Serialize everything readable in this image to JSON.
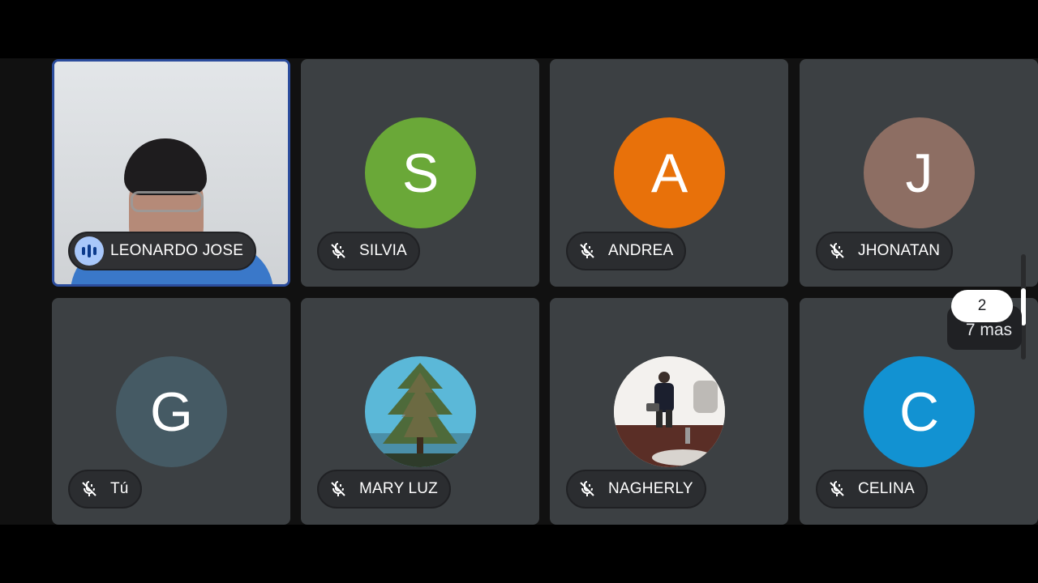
{
  "participants": [
    {
      "name": "LEONARDO JOSE",
      "type": "video",
      "speaking": true
    },
    {
      "name": "SILVIA",
      "initial": "S",
      "color": "#6aa838",
      "muted": true
    },
    {
      "name": "ANDREA",
      "initial": "A",
      "color": "#e8710a",
      "muted": true
    },
    {
      "name": "JHONATAN",
      "initial": "J",
      "color": "#8d6e63",
      "muted": true
    },
    {
      "name": "Tú",
      "initial": "G",
      "color": "#455a64",
      "muted": true
    },
    {
      "name": "MARY LUZ",
      "avatar": "tree-photo",
      "muted": true
    },
    {
      "name": "NAGHERLY",
      "avatar": "mirror-selfie-photo",
      "muted": true
    },
    {
      "name": "CELINA",
      "initial": "C",
      "color": "#1292d2",
      "muted": true
    }
  ],
  "overflow": {
    "badge": "2",
    "label": "7 mas"
  },
  "icons": {
    "muted": "mic-off-icon",
    "speaking": "audio-level-icon"
  },
  "colors": {
    "tile": "#3c4043",
    "active_border": "#2b4c9c",
    "stage": "#111111"
  }
}
